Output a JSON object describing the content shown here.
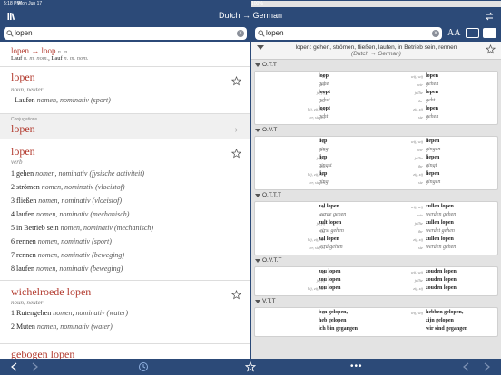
{
  "status": {
    "time": "5:18 PM",
    "date": "Mon Jun 17",
    "battery": "100%"
  },
  "nav": {
    "title": "Dutch → German"
  },
  "left_search": {
    "value": "lopen"
  },
  "right_search": {
    "value": "lopen"
  },
  "font_size_label": "AA",
  "entries": {
    "e1": {
      "head": "lopen → loop",
      "gram": "n. m.",
      "line2a": "Lauf",
      "line2b": "n. m. nom.",
      "line2c": ", Lauf",
      "line2d": "n. m. nom."
    },
    "e2": {
      "head": "lopen",
      "gram": "noun, neuter",
      "sense_word": "Laufen",
      "sense_gram": "nomen, nominativ",
      "sense_tag": "(sport)"
    },
    "conj": {
      "label": "Conjugations",
      "word": "lopen"
    },
    "e3": {
      "head": "lopen",
      "gram": "verb",
      "senses": [
        {
          "n": "1",
          "word": "gehen",
          "gram": "nomen, nominativ",
          "tag": "(fysische activiteit)"
        },
        {
          "n": "2",
          "word": "strömen",
          "gram": "nomen, nominativ",
          "tag": "(vloeistof)"
        },
        {
          "n": "3",
          "word": "fließen",
          "gram": "nomen, nominativ",
          "tag": "(vloeistof)"
        },
        {
          "n": "4",
          "word": "laufen",
          "gram": "nomen, nominativ",
          "tag": "(mechanisch)"
        },
        {
          "n": "5",
          "word": "in Betrieb sein",
          "gram": "nomen, nominativ",
          "tag": "(mechanisch)"
        },
        {
          "n": "6",
          "word": "rennen",
          "gram": "nomen, nominativ",
          "tag": "(sport)"
        },
        {
          "n": "7",
          "word": "rennen",
          "gram": "nomen, nominativ",
          "tag": "(beweging)"
        },
        {
          "n": "8",
          "word": "laufen",
          "gram": "nomen, nominativ",
          "tag": "(beweging)"
        }
      ]
    },
    "e4": {
      "head": "wichelroede lopen",
      "gram": "noun, neuter",
      "senses": [
        {
          "n": "1",
          "word": "Rutengehen",
          "gram": "nomen, nominativ",
          "tag": "(water)"
        },
        {
          "n": "2",
          "word": "Muten",
          "gram": "nomen, nominativ",
          "tag": "(water)"
        }
      ]
    },
    "e5": {
      "head": "gebogen lopen"
    }
  },
  "right_header": {
    "text": "lopen: gehen, strömen, fließen, laufen, in Betrieb sein, rennen",
    "sub": "(Dutch → German)"
  },
  "sections": [
    {
      "title": "O.T.T",
      "rows": [
        [
          "ik",
          "loop",
          "wij, wij",
          "lopen"
        ],
        [
          "ich",
          "gehe",
          "wir",
          "gehen"
        ],
        [
          "je, jij",
          "loopt",
          "jullie",
          "lopen"
        ],
        [
          "du",
          "gehst",
          "ihr",
          "geht"
        ],
        [
          "hij, zij, het",
          "loopt",
          "zij, zij",
          "lopen"
        ],
        [
          "er, sie, es",
          "geht",
          "sie",
          "gehen"
        ]
      ]
    },
    {
      "title": "O.V.T",
      "rows": [
        [
          "ik",
          "liep",
          "wij, wij",
          "liepen"
        ],
        [
          "ich",
          "ging",
          "wir",
          "gingen"
        ],
        [
          "je, jij",
          "liep",
          "jullie",
          "liepen"
        ],
        [
          "du",
          "gingst",
          "ihr",
          "gingt"
        ],
        [
          "hij, zij, het",
          "liep",
          "zij, zij",
          "liepen"
        ],
        [
          "er, sie, es",
          "ging",
          "sie",
          "gingen"
        ]
      ]
    },
    {
      "title": "O.T.T.T",
      "rows": [
        [
          "ik",
          "zal lopen",
          "wij, wij",
          "zullen lopen"
        ],
        [
          "ich",
          "werde gehen",
          "wir",
          "werden gehen"
        ],
        [
          "je, jij",
          "zult lopen",
          "jullie",
          "zullen lopen"
        ],
        [
          "du",
          "wirst gehen",
          "ihr",
          "werdet gehen"
        ],
        [
          "hij, zij, het",
          "zal lopen",
          "zij, zij",
          "zullen lopen"
        ],
        [
          "er, sie, es",
          "wird gehen",
          "sie",
          "werden gehen"
        ]
      ]
    },
    {
      "title": "O.V.T.T",
      "rows": [
        [
          "ik",
          "zou lopen",
          "wij, wij",
          "zouden lopen"
        ],
        [
          "je, jij",
          "zou lopen",
          "jullie",
          "zouden lopen"
        ],
        [
          "hij, zij, het",
          "zou lopen",
          "zij, zij",
          "zouden lopen"
        ]
      ]
    },
    {
      "title": "V.T.T",
      "rows": [
        [
          "ik",
          "ben gelopen,",
          "wij, wij",
          "hebben gelopen,"
        ],
        [
          "",
          "heb gelopen",
          "",
          "zijn gelopen"
        ],
        [
          "",
          "ich bin gegangen",
          "",
          "wir sind gegangen"
        ]
      ]
    }
  ],
  "colors": {
    "bar": "#2c4a78",
    "headword": "#b23a2e"
  },
  "icons": [
    "library-icon",
    "swap-icon",
    "search-icon",
    "clear-icon",
    "star-icon",
    "chevron-right-icon",
    "back-icon",
    "forward-icon",
    "history-icon",
    "favorites-icon",
    "more-icon",
    "single-pane-icon",
    "split-pane-icon"
  ]
}
